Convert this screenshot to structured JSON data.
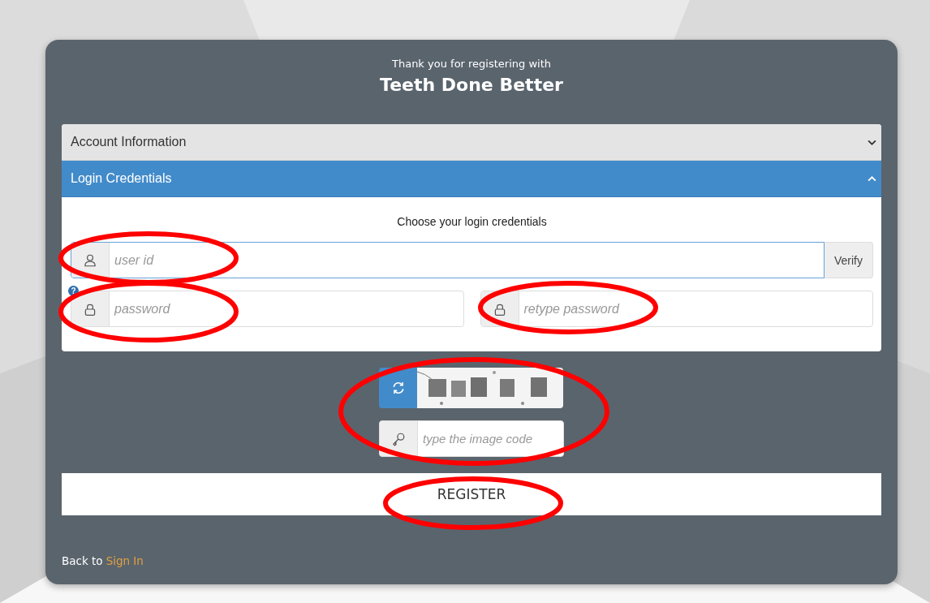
{
  "header": {
    "subtitle": "Thank you for registering with",
    "title": "Teeth Done Better"
  },
  "sections": [
    {
      "title": "Account Information",
      "expanded": false
    },
    {
      "title": "Login Credentials",
      "expanded": true
    }
  ],
  "credentials": {
    "instruction": "Choose your login credentials",
    "user_id": {
      "placeholder": "user id",
      "button": "Verify"
    },
    "password": {
      "placeholder": "password",
      "help": "?"
    },
    "retype_password": {
      "placeholder": "retype password"
    }
  },
  "captcha": {
    "placeholder": "type the image code"
  },
  "register_button": "REGISTER",
  "footer": {
    "text": "Back to",
    "link": "Sign In"
  }
}
